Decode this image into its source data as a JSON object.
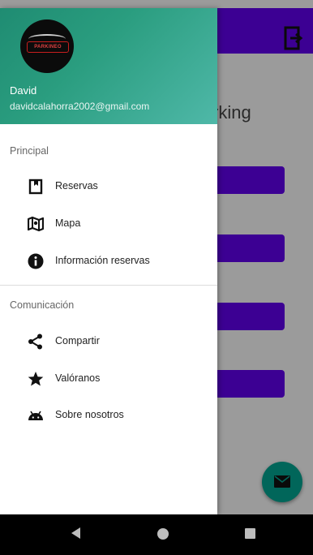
{
  "drawer": {
    "header": {
      "avatar_logo_text": "PARKINEO",
      "user_name": "David",
      "user_email": "davidcalahorra2002@gmail.com"
    },
    "section_principal": "Principal",
    "principal_items": [
      {
        "label": "Reservas",
        "icon": "bookmark-icon"
      },
      {
        "label": "Mapa",
        "icon": "map-icon"
      },
      {
        "label": "Información reservas",
        "icon": "info-icon"
      }
    ],
    "section_comunicacion": "Comunicación",
    "comunicacion_items": [
      {
        "label": "Compartir",
        "icon": "share-icon"
      },
      {
        "label": "Valóranos",
        "icon": "star-icon"
      },
      {
        "label": "Sobre nosotros",
        "icon": "android-icon"
      }
    ]
  },
  "background": {
    "title_fragment": "rking"
  },
  "colors": {
    "primary": "#6200ee",
    "header_gradient_start": "#1f8c72",
    "header_gradient_end": "#4fb8a8",
    "fab": "#03a592"
  }
}
